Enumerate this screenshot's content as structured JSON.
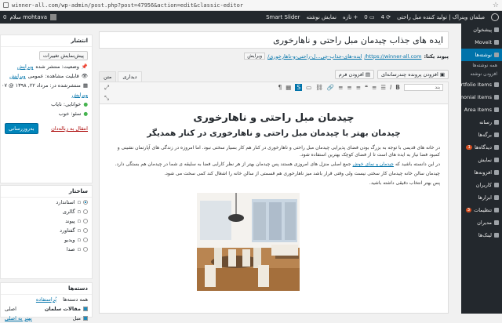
{
  "browser": {
    "url": "winner-all.com/wp-admin/post.php?post=47956&action=edit&classic-editor"
  },
  "adminbar": {
    "site_name": "مبلمان وینراک | تولید کننده مبل راحتی",
    "updates": "4",
    "comments": "0",
    "new_label": "+ تازه",
    "view_post": "نمایش نوشته",
    "smart_slider": "Smart Slider",
    "greeting": "سلام mohtava",
    "notif_count": "0"
  },
  "sidebar": {
    "items": [
      {
        "label": "پیشخوان",
        "active": false
      },
      {
        "label": "Moveit",
        "active": false
      },
      {
        "label": "نوشته‌ها",
        "active": true
      },
      {
        "label": "همه نوشته‌ها",
        "sub": true
      },
      {
        "label": "افزودن نوشته",
        "sub": true
      },
      {
        "label": "Portfolio Items",
        "active": false
      },
      {
        "label": "Testimonial Items",
        "active": false
      },
      {
        "label": "Area Items",
        "active": false
      },
      {
        "label": "رسانه",
        "active": false
      },
      {
        "label": "برگه‌ها",
        "active": false
      },
      {
        "label": "دیدگاه‌ها",
        "active": false,
        "badge": "1"
      },
      {
        "label": "نمایش",
        "active": false
      },
      {
        "label": "افزونه‌ها",
        "active": false
      },
      {
        "label": "کاربران",
        "active": false
      },
      {
        "label": "ابزارها",
        "active": false
      },
      {
        "label": "تنظیمات",
        "active": false,
        "badge": "3"
      },
      {
        "label": "مدیران",
        "active": false
      },
      {
        "label": "لینک‌ها",
        "active": false
      }
    ]
  },
  "post": {
    "title": "ایده های جذاب چیدمان مبل راحتی و ناهارخوری",
    "permalink_label": "پیوند یکتا:",
    "permalink_base": "https://winner-all.com/",
    "permalink_slug": "ایده-های-جذاب-چی...ل-راحتی-و-ناهارخوری/",
    "edit_label": "ویرایش",
    "add_media": "افزودن پرونده چندرسانه‌ای",
    "add_form": "افزودن فرم",
    "tab_visual": "دیداری",
    "tab_text": "متن",
    "format_select": "بند"
  },
  "content": {
    "h1": "چیدمان مبل راحتی و ناهارخوری",
    "h2": "چیدمان بهتر با  چیدمان مبل راحتی و ناهارخوری در کنار همدیگر",
    "p1": "در خانه های قدیمی با توجه به بزرگ بودن فضای پذیرایی چیدمان مبل راحتی و ناهارخوری در کنار هم کار بسیار سختی نبود. اما امروزه در زندگی های آپارتمان نشینی و کمبود فضا نیاز به ایده های است تا از فضای کوچک بهترین استفاده شود.",
    "p2_before": "در این دانسته باشید که ",
    "p2_link": "چیدمان و نمای خوش",
    "p2_after": " جمع اصلی منزل های امروزی هستند پس چیدمان بهتر از هر نظر کارایی فضا به سلیقه ی شما در چیدمان هم بستگی دارد.",
    "p3": "چیدمان سالن خانه چیدمان کار سختی نیست ولی وقتی قرار باشد میز ناهارخوری هم قسمتی از سالن خانه را اشغال کند کمی سخت می شود.",
    "p4": "پس بهتر انتخاب دقیقی داشته باشید."
  },
  "publish": {
    "header": "انتشار",
    "preview_btn": "پیش‌نمایش تغییرات",
    "status_label": "وضعیت: منتشر شده",
    "status_edit": "ویرایش",
    "visibility_label": "قابلیت مشاهده: عمومی",
    "visibility_edit": "ویرایش",
    "published_on": "منتشرشده در: مرداد ۲۲, ۱۳۹۸ @ ۰۷",
    "date_edit": "ویرایش",
    "readability": "خوانایی: نایاب",
    "seo": "سئو: خوب",
    "trash": "انتقال به زباله‌دان",
    "update_btn": "به‌روزرسانی"
  },
  "format": {
    "header": "ساختار",
    "options": [
      {
        "label": "استاندارد",
        "selected": true
      },
      {
        "label": "گالری",
        "selected": false
      },
      {
        "label": "پیوند",
        "selected": false
      },
      {
        "label": "گفتاورد",
        "selected": false
      },
      {
        "label": "ویدیو",
        "selected": false
      },
      {
        "label": "صدا",
        "selected": false
      }
    ]
  },
  "categories": {
    "header": "دسته‌ها",
    "tab_all": "همه دسته‌ها",
    "tab_popular": "پُراستفاده",
    "items": [
      {
        "label": "مقالات سلمان",
        "checked": true,
        "primary": "اصلی"
      },
      {
        "label": "مبل",
        "checked": true,
        "primary": "بهتر به اصلی"
      }
    ]
  },
  "colors": {
    "admin_dark": "#23282d",
    "accent": "#0073aa",
    "button": "#0085ba"
  }
}
